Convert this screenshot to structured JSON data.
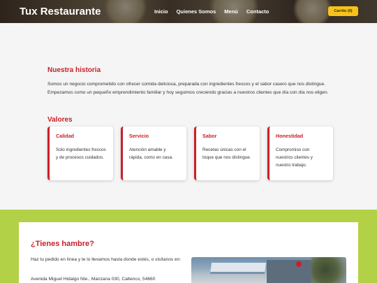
{
  "header": {
    "brand": "Tux Restaurante",
    "nav": [
      "Inicio",
      "Quienes Somos",
      "Menú",
      "Contacto"
    ],
    "cart_label": "Carrito (0)"
  },
  "history": {
    "title": "Nuestra historia",
    "text": "Somos un negocio comprometido con ofrecer comida deliciosa, preparada con ingredientes frescos y el sabor casero que nos distingue. Empezamos como un pequeño emprendimiento familiar y hoy seguimos creciendo gracias a nuestros clientes que día con día nos eligen."
  },
  "values": {
    "title": "Valores",
    "cards": [
      {
        "title": "Calidad",
        "text": "Solo ingredientes frescos y de procesos cuidados."
      },
      {
        "title": "Servicio",
        "text": "Atención amable y rápida, como en casa."
      },
      {
        "title": "Sabor",
        "text": "Recetas únicas con el toque que nos distingue."
      },
      {
        "title": "Honestidad",
        "text": "Compromiso con nuestros clientes y nuestro trabajo."
      }
    ]
  },
  "contact": {
    "title": "¿Tienes hambre?",
    "text": "Haz tu pedido en línea y te lo llevamos hasta donde estés, o visítanos en:",
    "address": "Avenida Miguel Hidalgo Nte., Manzana 030, Caltenco, 54660"
  },
  "colors": {
    "accent": "#c8202a",
    "cart_button": "#f7c21a",
    "green_band": "#b3d146"
  }
}
